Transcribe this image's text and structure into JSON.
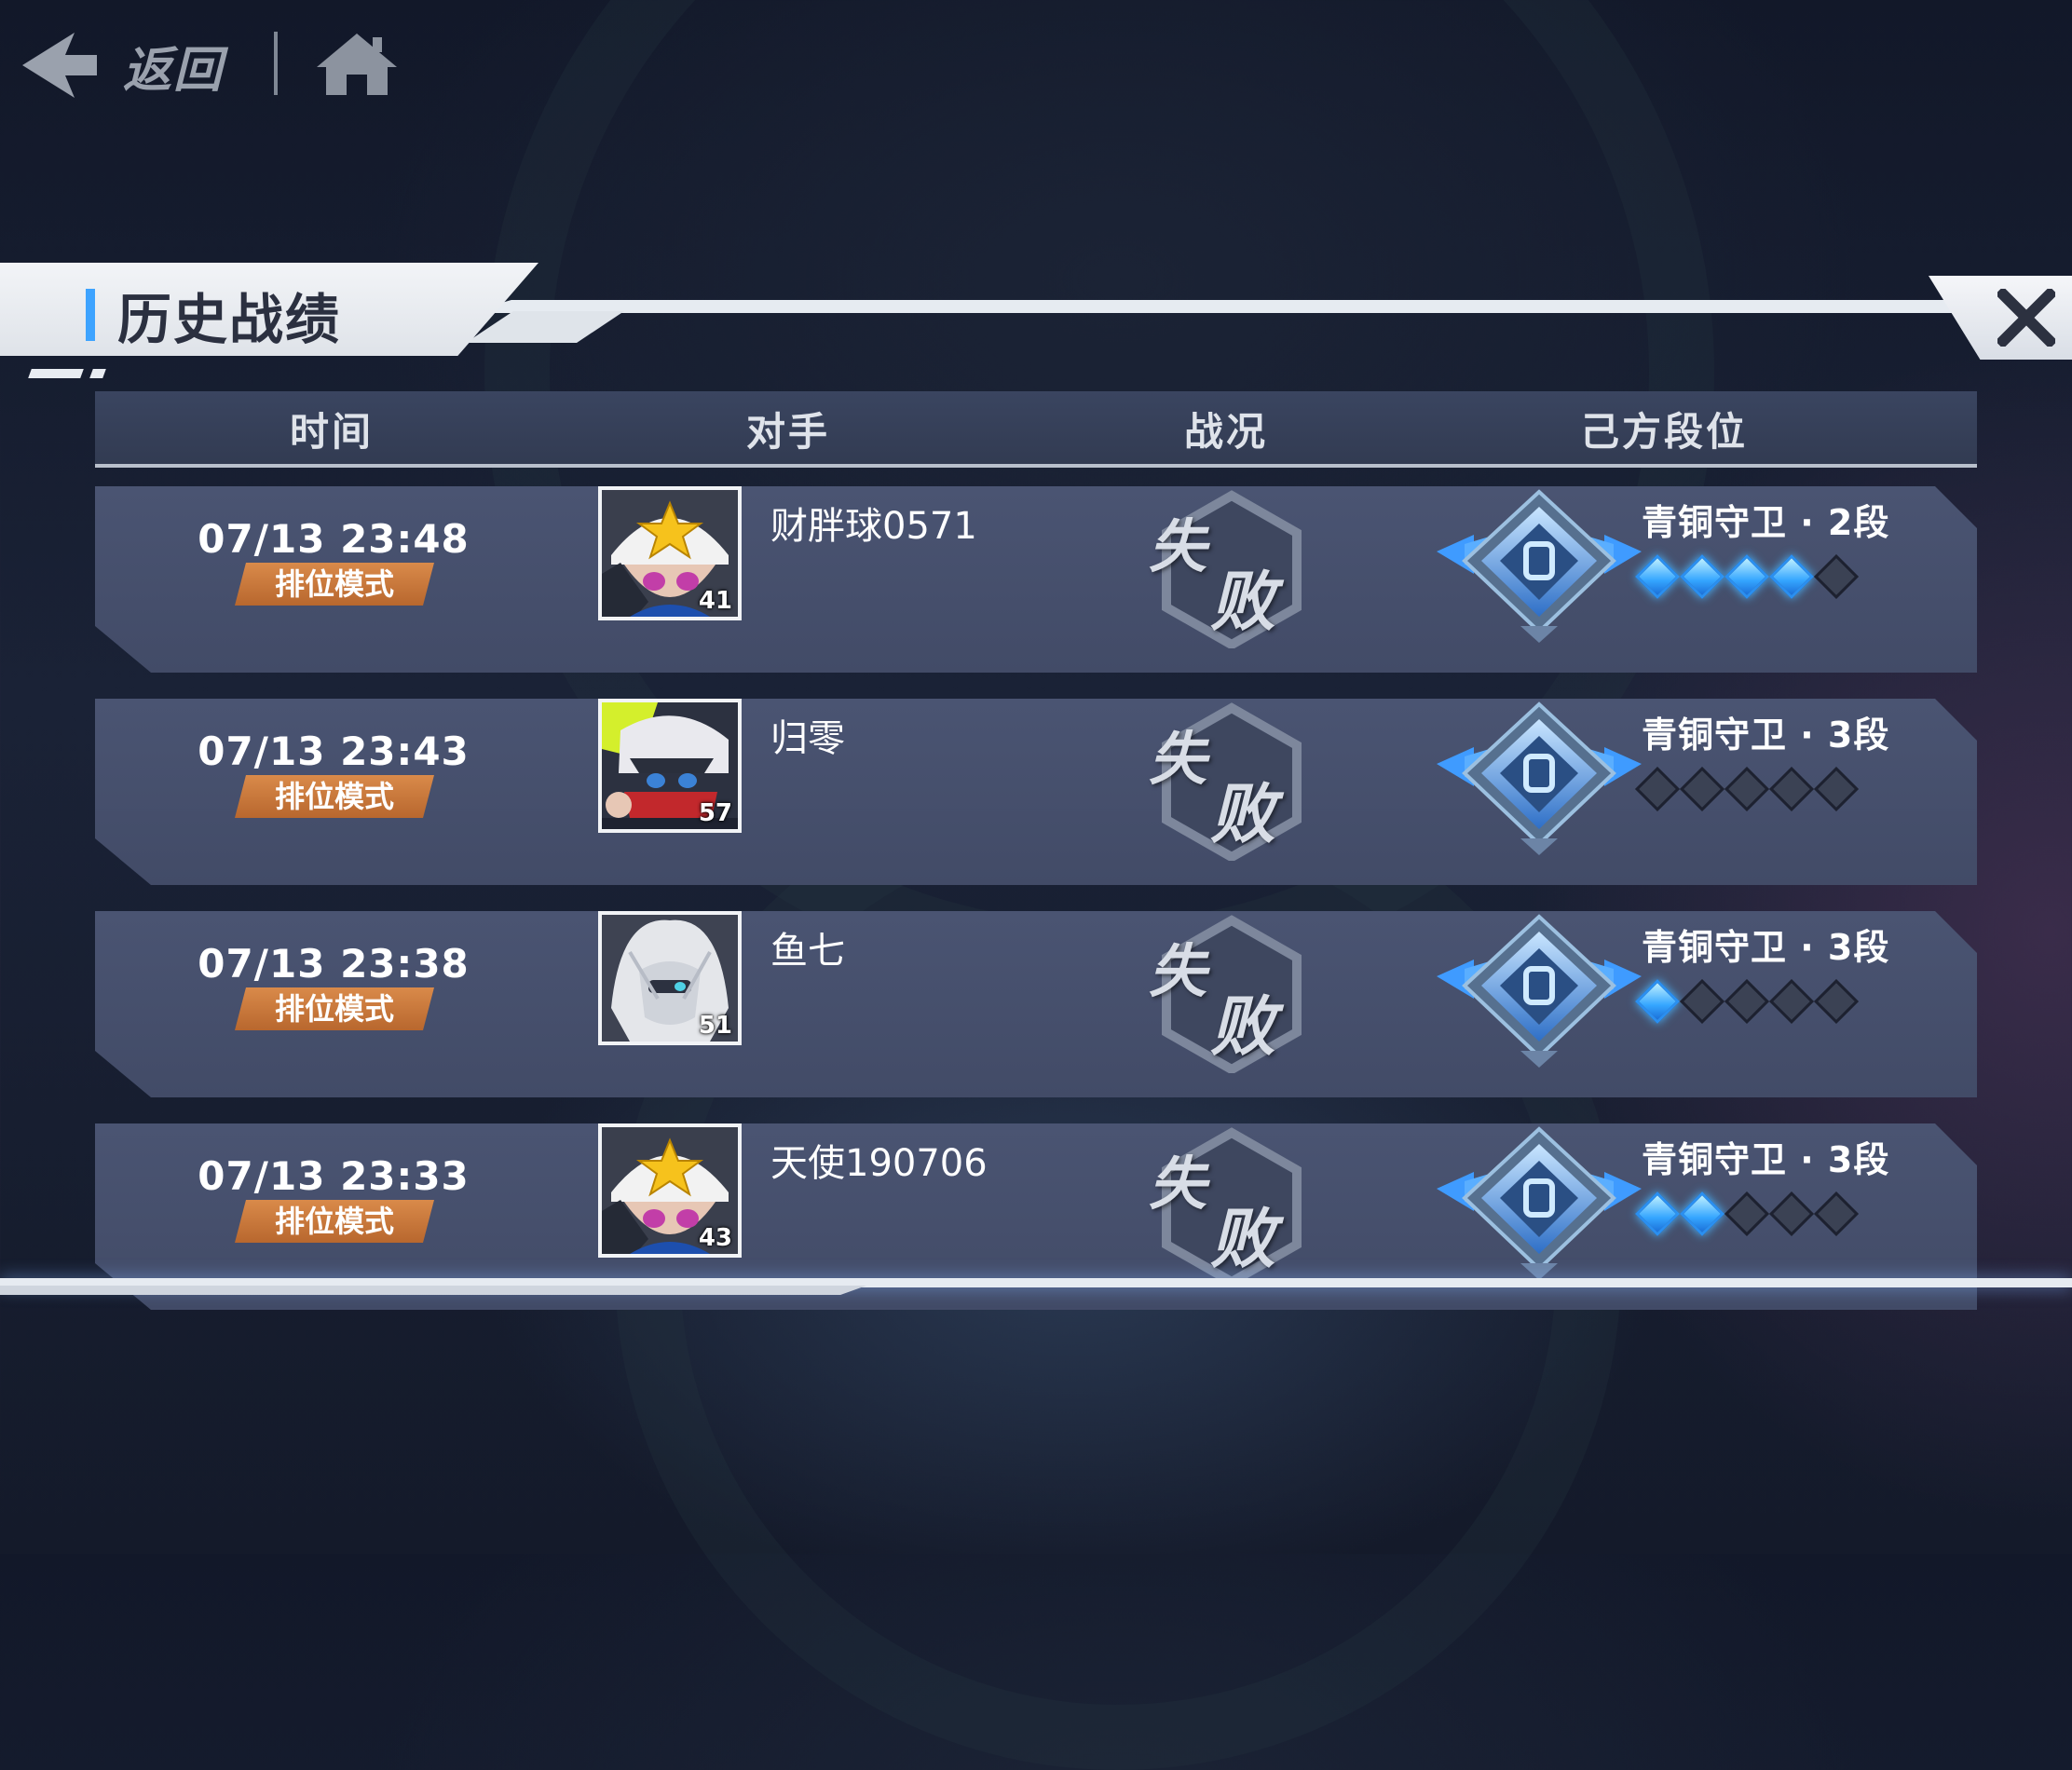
{
  "nav": {
    "back_label": "返回"
  },
  "panel": {
    "title": "历史战绩"
  },
  "table": {
    "headers": {
      "time": "时间",
      "opponent": "对手",
      "result": "战况",
      "rank": "己方段位"
    },
    "rows": [
      {
        "time": "07/13 23:48",
        "mode": "排位模式",
        "opponent": "财胖球0571",
        "opponent_level": "41",
        "avatar": "white-hat-star-character",
        "result_char1": "失",
        "result_char2": "败",
        "rank": "青铜守卫 · 2段",
        "stars_filled": 4,
        "stars_total": 5
      },
      {
        "time": "07/13 23:43",
        "mode": "排位模式",
        "opponent": "归零",
        "opponent_level": "57",
        "avatar": "masked-ninja-character",
        "result_char1": "失",
        "result_char2": "败",
        "rank": "青铜守卫 · 3段",
        "stars_filled": 0,
        "stars_total": 5
      },
      {
        "time": "07/13 23:38",
        "mode": "排位模式",
        "opponent": "鱼七",
        "opponent_level": "51",
        "avatar": "white-hair-character",
        "result_char1": "失",
        "result_char2": "败",
        "rank": "青铜守卫 · 3段",
        "stars_filled": 1,
        "stars_total": 5
      },
      {
        "time": "07/13 23:33",
        "mode": "排位模式",
        "opponent": "天使190706",
        "opponent_level": "43",
        "avatar": "white-hat-star-character",
        "result_char1": "失",
        "result_char2": "败",
        "rank": "青铜守卫 · 3段",
        "stars_filled": 2,
        "stars_total": 5
      }
    ]
  },
  "colors": {
    "accent_blue": "#3da3ff",
    "mode_badge": "#c97a3c",
    "star_on": "#35a6ff",
    "row_bg": "#454f6c"
  }
}
